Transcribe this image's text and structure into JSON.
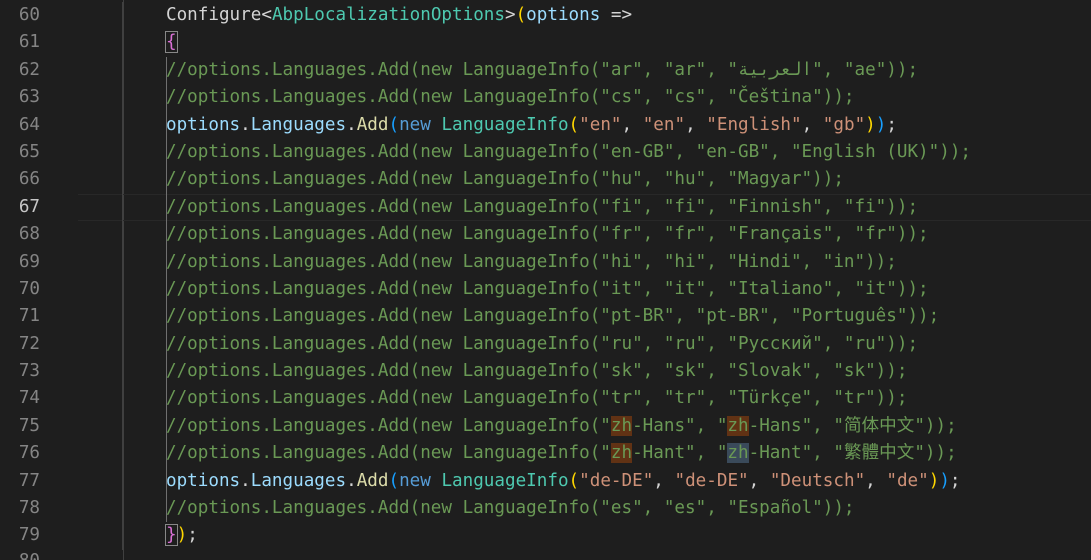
{
  "editor": {
    "first_line": 60,
    "active_line": 67,
    "language": "csharp",
    "colors": {
      "background": "#1e1e1e",
      "comment": "#6a9955",
      "keyword": "#569cd6",
      "type": "#4ec9b0",
      "method": "#dcdcaa",
      "variable": "#9cdcfe",
      "string": "#ce9178",
      "line_number": "#858585",
      "find_highlight": "#613214"
    },
    "lines": [
      {
        "number": "60",
        "text": "Configure<AbpLocalizationOptions>(options =>"
      },
      {
        "number": "61",
        "text": "{"
      },
      {
        "number": "62",
        "text": "//options.Languages.Add(new LanguageInfo(\"ar\", \"ar\", \"العربية\", \"ae\"));"
      },
      {
        "number": "63",
        "text": "//options.Languages.Add(new LanguageInfo(\"cs\", \"cs\", \"Čeština\"));"
      },
      {
        "number": "64",
        "text": "options.Languages.Add(new LanguageInfo(\"en\", \"en\", \"English\", \"gb\"));"
      },
      {
        "number": "65",
        "text": "//options.Languages.Add(new LanguageInfo(\"en-GB\", \"en-GB\", \"English (UK)\"));"
      },
      {
        "number": "66",
        "text": "//options.Languages.Add(new LanguageInfo(\"hu\", \"hu\", \"Magyar\"));"
      },
      {
        "number": "67",
        "text": "//options.Languages.Add(new LanguageInfo(\"fi\", \"fi\", \"Finnish\", \"fi\"));"
      },
      {
        "number": "68",
        "text": "//options.Languages.Add(new LanguageInfo(\"fr\", \"fr\", \"Français\", \"fr\"));"
      },
      {
        "number": "69",
        "text": "//options.Languages.Add(new LanguageInfo(\"hi\", \"hi\", \"Hindi\", \"in\"));"
      },
      {
        "number": "70",
        "text": "//options.Languages.Add(new LanguageInfo(\"it\", \"it\", \"Italiano\", \"it\"));"
      },
      {
        "number": "71",
        "text": "//options.Languages.Add(new LanguageInfo(\"pt-BR\", \"pt-BR\", \"Português\"));"
      },
      {
        "number": "72",
        "text": "//options.Languages.Add(new LanguageInfo(\"ru\", \"ru\", \"Русский\", \"ru\"));"
      },
      {
        "number": "73",
        "text": "//options.Languages.Add(new LanguageInfo(\"sk\", \"sk\", \"Slovak\", \"sk\"));"
      },
      {
        "number": "74",
        "text": "//options.Languages.Add(new LanguageInfo(\"tr\", \"tr\", \"Türkçe\", \"tr\"));"
      },
      {
        "number": "75",
        "text": "//options.Languages.Add(new LanguageInfo(\"zh-Hans\", \"zh-Hans\", \"简体中文\"));"
      },
      {
        "number": "76",
        "text": "//options.Languages.Add(new LanguageInfo(\"zh-Hant\", \"zh-Hant\", \"繁體中文\"));"
      },
      {
        "number": "77",
        "text": "options.Languages.Add(new LanguageInfo(\"de-DE\", \"de-DE\", \"Deutsch\", \"de\"));"
      },
      {
        "number": "78",
        "text": "//options.Languages.Add(new LanguageInfo(\"es\", \"es\", \"Español\"));"
      },
      {
        "number": "79",
        "text": "});"
      },
      {
        "number": "80",
        "text": ""
      }
    ],
    "tokens": {
      "configure": "Configure",
      "lt": "<",
      "abp_type": "AbpLocalizationOptions",
      "gt": ">",
      "paren_open": "(",
      "options": "options",
      "arrow": " =>",
      "brace_open": "{",
      "l64_options": "options",
      "dot": ".",
      "languages": "Languages",
      "add": "Add",
      "kw_new": "new",
      "lang_info": "LanguageInfo",
      "en": "\"en\"",
      "english": "\"English\"",
      "gb": "\"gb\"",
      "comma": ", ",
      "close_semi": ");",
      "close_paren": ")",
      "de_de": "\"de-DE\"",
      "deutsch": "\"Deutsch\"",
      "de": "\"de\"",
      "brace_close": "}",
      "c75_pre": "//options.Languages.Add(new LanguageInfo(\"",
      "zh": "zh",
      "c75_mid1": "-Hans\", \"",
      "c75_mid2": "-Hans\", \"简体中文\"));",
      "c76_mid1": "-Hant\", \"",
      "c76_mid2": "-Hant\", \"繁體中文\"));"
    }
  }
}
